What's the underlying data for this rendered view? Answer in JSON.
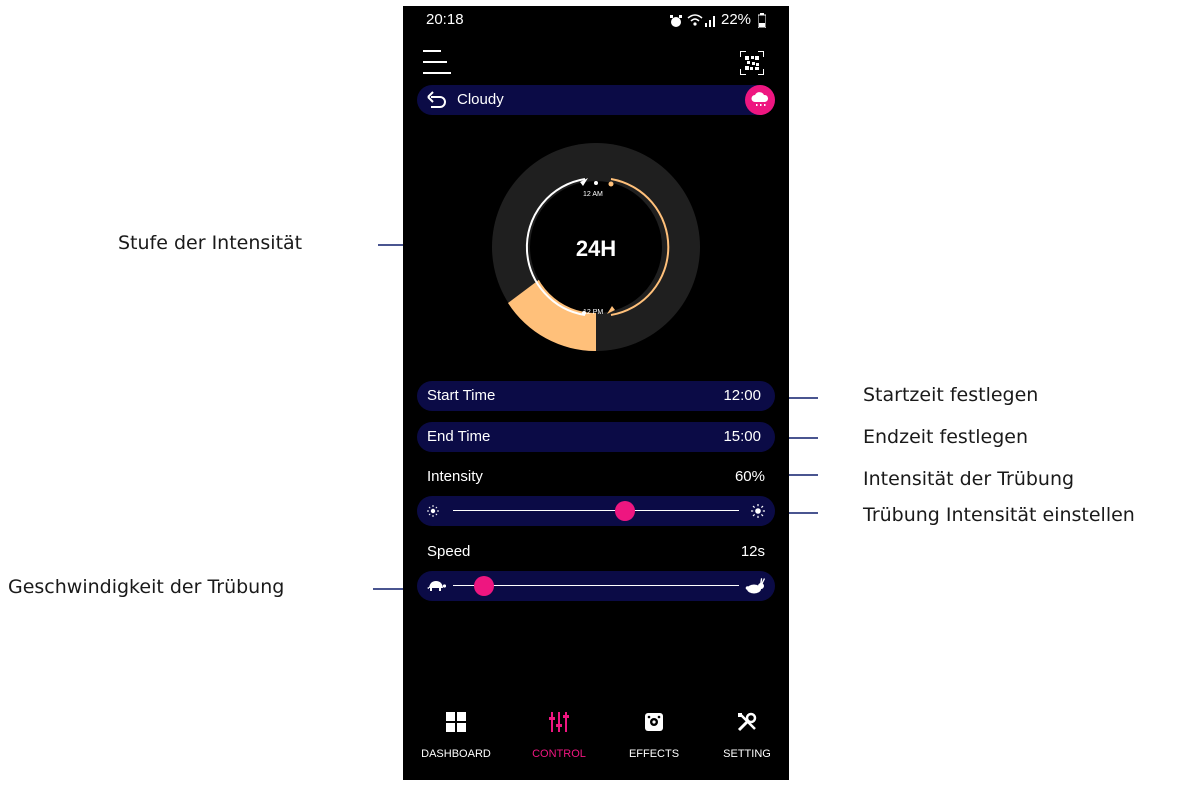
{
  "annotations": {
    "intensity_level": "Stufe der Intensität",
    "set_start": "Startzeit festlegen",
    "set_end": "Endzeit festlegen",
    "cloud_intensity": "Intensität der Trübung",
    "set_cloud_intensity": "Trübung Intensität einstellen",
    "cloud_speed": "Geschwindigkeit der Trübung"
  },
  "status_bar": {
    "time": "20:18",
    "battery": "22%",
    "icons": [
      "alarm-icon",
      "wifi-icon",
      "signal-icon",
      "battery-icon"
    ]
  },
  "header": {
    "menu_icon": "hamburger-menu-icon",
    "qr_icon": "qr-code-icon"
  },
  "mode": {
    "label": "Cloudy",
    "back_icon": "back-arrow-icon",
    "weather_icon": "cloud-rain-icon"
  },
  "dial": {
    "center_label": "24H",
    "top_label": "12 AM",
    "bottom_label": "12 PM",
    "arc_color": "#ffc07a",
    "intensity_fraction": 0.6
  },
  "start_time": {
    "label": "Start Time",
    "value": "12:00"
  },
  "end_time": {
    "label": "End Time",
    "value": "15:00"
  },
  "intensity": {
    "label": "Intensity",
    "value": "60%",
    "level": 0.6,
    "min_icon": "sun-dim-icon",
    "max_icon": "sun-bright-icon"
  },
  "speed": {
    "label": "Speed",
    "value": "12s",
    "level": 0.11,
    "min_icon": "turtle-icon",
    "max_icon": "rabbit-icon"
  },
  "bottom_nav": [
    {
      "label": "DASHBOARD",
      "icon": "dashboard-grid-icon",
      "active": false
    },
    {
      "label": "CONTROL",
      "icon": "sliders-icon",
      "active": true
    },
    {
      "label": "EFFECTS",
      "icon": "effects-icon",
      "active": false
    },
    {
      "label": "SETTING",
      "icon": "tools-icon",
      "active": false
    }
  ],
  "colors": {
    "accent": "#ee1680",
    "pill_bg": "#0b0b46",
    "dial_ring": "#1f1f1f",
    "annotation_line": "#4a5590"
  }
}
